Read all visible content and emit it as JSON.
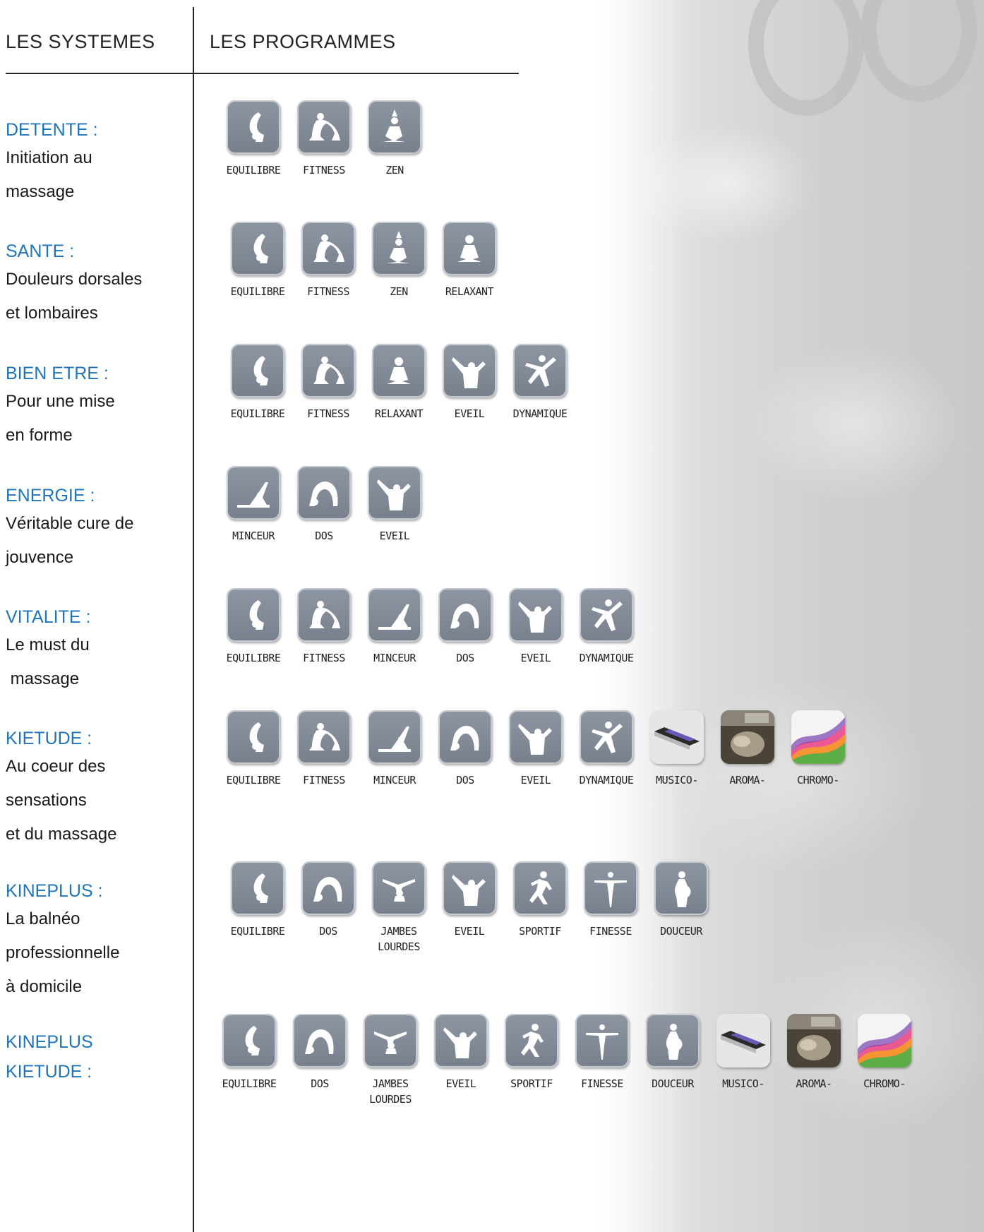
{
  "headers": {
    "systems": "LES SYSTEMES",
    "programs": "LES PROGRAMMES"
  },
  "systems": [
    {
      "name": "DETENTE :",
      "lines": [
        "Initiation au",
        "massage"
      ],
      "programs": [
        {
          "label": "EQUILIBRE",
          "icon": "equilibre-icon"
        },
        {
          "label": "FITNESS",
          "icon": "fitness-icon"
        },
        {
          "label": "ZEN",
          "icon": "zen-icon"
        }
      ]
    },
    {
      "name": "SANTE :",
      "lines": [
        "Douleurs dorsales",
        "et lombaires"
      ],
      "programs": [
        {
          "label": "EQUILIBRE",
          "icon": "equilibre-icon"
        },
        {
          "label": "FITNESS",
          "icon": "fitness-icon"
        },
        {
          "label": "ZEN",
          "icon": "zen-icon"
        },
        {
          "label": "RELAXANT",
          "icon": "relaxant-icon"
        }
      ]
    },
    {
      "name": "BIEN ETRE :",
      "lines": [
        "Pour une mise",
        "en forme"
      ],
      "programs": [
        {
          "label": "EQUILIBRE",
          "icon": "equilibre-icon"
        },
        {
          "label": "FITNESS",
          "icon": "fitness-icon"
        },
        {
          "label": "RELAXANT",
          "icon": "relaxant-icon"
        },
        {
          "label": "EVEIL",
          "icon": "eveil-icon"
        },
        {
          "label": "DYNAMIQUE",
          "icon": "dynamique-icon"
        }
      ]
    },
    {
      "name": "ENERGIE :",
      "lines": [
        "Véritable cure de",
        "jouvence"
      ],
      "programs": [
        {
          "label": "MINCEUR",
          "icon": "minceur-icon"
        },
        {
          "label": "DOS",
          "icon": "dos-icon"
        },
        {
          "label": "EVEIL",
          "icon": "eveil-icon"
        }
      ]
    },
    {
      "name": "VITALITE :",
      "lines": [
        "Le must du",
        " massage"
      ],
      "programs": [
        {
          "label": "EQUILIBRE",
          "icon": "equilibre-icon"
        },
        {
          "label": "FITNESS",
          "icon": "fitness-icon"
        },
        {
          "label": "MINCEUR",
          "icon": "minceur-icon"
        },
        {
          "label": "DOS",
          "icon": "dos-icon"
        },
        {
          "label": "EVEIL",
          "icon": "eveil-icon"
        },
        {
          "label": "DYNAMIQUE",
          "icon": "dynamique-icon"
        }
      ]
    },
    {
      "name": "KIETUDE :",
      "lines": [
        "Au coeur des",
        "sensations",
        "et du massage"
      ],
      "programs": [
        {
          "label": "EQUILIBRE",
          "icon": "equilibre-icon"
        },
        {
          "label": "FITNESS",
          "icon": "fitness-icon"
        },
        {
          "label": "MINCEUR",
          "icon": "minceur-icon"
        },
        {
          "label": "DOS",
          "icon": "dos-icon"
        },
        {
          "label": "EVEIL",
          "icon": "eveil-icon"
        },
        {
          "label": "DYNAMIQUE",
          "icon": "dynamique-icon"
        },
        {
          "label": "MUSICO-",
          "icon": "musico-icon"
        },
        {
          "label": "AROMA-",
          "icon": "aroma-icon"
        },
        {
          "label": "CHROMO-",
          "icon": "chromo-icon"
        }
      ]
    },
    {
      "name": "KINEPLUS :",
      "lines": [
        "La balnéo",
        "professionnelle",
        "à domicile"
      ],
      "programs": [
        {
          "label": "EQUILIBRE",
          "icon": "equilibre-icon"
        },
        {
          "label": "DOS",
          "icon": "dos-icon"
        },
        {
          "label": "JAMBES\nLOURDES",
          "icon": "jambes-lourdes-icon"
        },
        {
          "label": "EVEIL",
          "icon": "eveil-icon"
        },
        {
          "label": "SPORTIF",
          "icon": "sportif-icon"
        },
        {
          "label": "FINESSE",
          "icon": "finesse-icon"
        },
        {
          "label": "DOUCEUR",
          "icon": "douceur-icon"
        }
      ]
    },
    {
      "name": "KINEPLUS\nKIETUDE :",
      "lines": [],
      "programs": [
        {
          "label": "EQUILIBRE",
          "icon": "equilibre-icon"
        },
        {
          "label": "DOS",
          "icon": "dos-icon"
        },
        {
          "label": "JAMBES\nLOURDES",
          "icon": "jambes-lourdes-icon"
        },
        {
          "label": "EVEIL",
          "icon": "eveil-icon"
        },
        {
          "label": "SPORTIF",
          "icon": "sportif-icon"
        },
        {
          "label": "FINESSE",
          "icon": "finesse-icon"
        },
        {
          "label": "DOUCEUR",
          "icon": "douceur-icon"
        },
        {
          "label": "MUSICO-",
          "icon": "musico-icon"
        },
        {
          "label": "AROMA-",
          "icon": "aroma-icon"
        },
        {
          "label": "CHROMO-",
          "icon": "chromo-icon"
        }
      ]
    }
  ]
}
